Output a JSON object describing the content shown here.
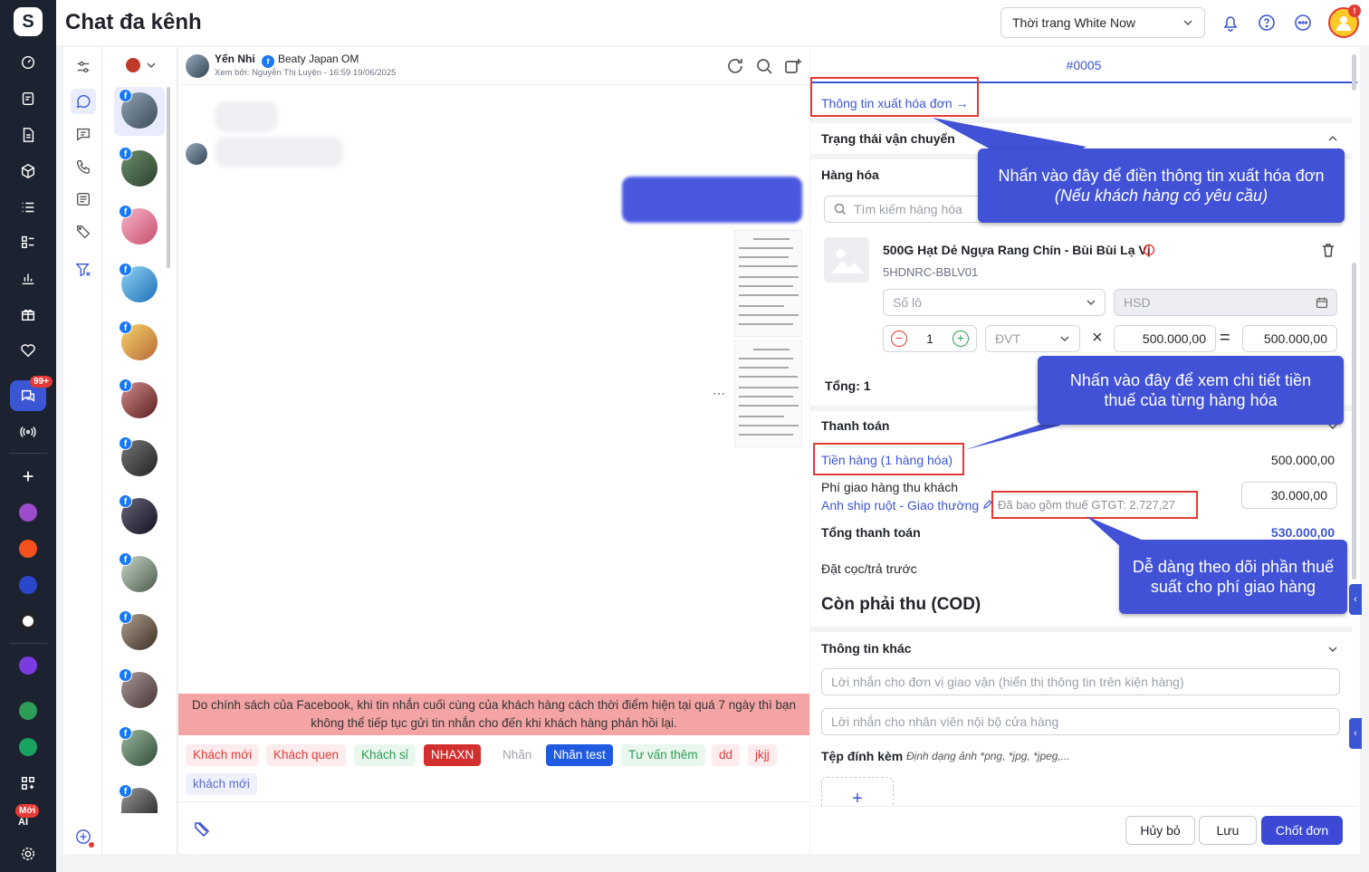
{
  "app": {
    "title": "Chat đa kênh",
    "store_selector": "Thời trang White Now",
    "avatar_notice": "!"
  },
  "rail": {
    "badge_count": "99+",
    "new_label": "Mới",
    "ai_label": "AI"
  },
  "chat": {
    "customer_name": "Yến Nhi",
    "page_name": "Beaty Japan OM",
    "seen_by": "Xem bởi: Nguyễn Thị Luyện - 16:59 19/06/2025",
    "policy_warning": "Do chính sách của Facebook, khi tin nhắn cuối cùng của khách hàng cách thời điểm hiện tại quá 7 ngày thì bạn không thể tiếp tục gửi tin nhắn cho đến khi khách hàng phản hồi lại.",
    "more": "⋯",
    "tags": [
      {
        "label": "Khách mới",
        "bg": "#fdecee",
        "fg": "#e53935"
      },
      {
        "label": "Khách quen",
        "bg": "#fdecee",
        "fg": "#e53935"
      },
      {
        "label": "Khách sỉ",
        "bg": "#e9f7ee",
        "fg": "#2e9d57"
      },
      {
        "label": "NHAXN",
        "bg": "#d32f2f",
        "fg": "#ffffff"
      },
      {
        "label": "Nhãn",
        "bg": "#ffffff",
        "fg": "#a0a4aa"
      },
      {
        "label": "Nhãn test",
        "bg": "#1f5ae0",
        "fg": "#ffffff"
      },
      {
        "label": "Tư vấn thêm",
        "bg": "#e9f7ee",
        "fg": "#2e9d57"
      },
      {
        "label": "dd",
        "bg": "#fdecee",
        "fg": "#e53935"
      },
      {
        "label": "jkjj",
        "bg": "#fdecee",
        "fg": "#e53935"
      },
      {
        "label": "khách mới",
        "bg": "#eef1fb",
        "fg": "#5c6bd4"
      }
    ]
  },
  "order": {
    "tab": "#0005",
    "invoice_link": "Thông tin xuất hóa đơn",
    "invoice_arrow": "→",
    "shipping_status": "Trạng thái vận chuyển",
    "goods_title": "Hàng hóa",
    "search_placeholder": "Tìm kiếm hàng hóa",
    "product": {
      "name": "500G Hạt Dẻ Ngựa Rang Chín - Bùi Bùi Lạ Vị",
      "sku": "5HDNRC-BBLV01",
      "lot_placeholder": "Số lô",
      "expiry_placeholder": "HSD",
      "qty": "1",
      "unit_placeholder": "ĐVT",
      "times": "×",
      "equals": "=",
      "price": "500.000,00",
      "line_total": "500.000,00"
    },
    "total_label": "Tổng: 1",
    "payment_title": "Thanh toán",
    "goods_amount_label": "Tiền hàng (1 hàng hóa)",
    "goods_amount": "500.000,00",
    "ship_fee_label": "Phí giao hàng thu khách",
    "ship_method": "Anh ship ruột - Giao thường",
    "ship_tax_note": "Đã bao gồm thuế GTGT: 2.727,27",
    "ship_fee": "30.000,00",
    "grand_total_label": "Tổng thanh toán",
    "grand_total": "530.000,00",
    "deposit_label": "Đặt cọc/trả trước",
    "cod_label": "Còn phải thu (COD)",
    "other_info": "Thông tin khác",
    "carrier_note_placeholder": "Lời nhắn cho đơn vị giao vận (hiển thị thông tin trên kiện hàng)",
    "internal_note_placeholder": "Lời nhắn cho nhân viên nội bộ cửa hàng",
    "attach_label": "Tệp đính kèm",
    "attach_hint": "Định dạng ảnh *png, *jpg, *jpeg,...",
    "add": "+",
    "cancel": "Hủy bỏ",
    "save": "Lưu",
    "confirm": "Chốt đơn"
  },
  "callouts": {
    "invoice_main": "Nhấn vào đây để điền thông tin xuất hóa đơn",
    "invoice_note": "(Nếu khách hàng có yêu cầu)",
    "tax_detail": "Nhấn vào đây để xem chi tiết tiền thuế của từng hàng hóa",
    "ship_tax": "Dễ dàng theo dõi phần thuế suất cho phí giao hàng"
  }
}
